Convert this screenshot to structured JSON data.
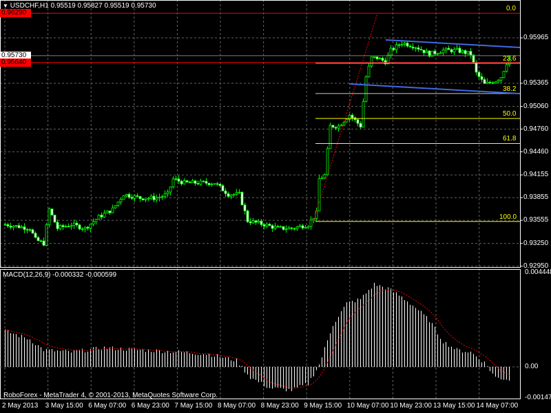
{
  "header": {
    "symbol_line": "USDCHF,H1  0.95519 0.95827 0.95519 0.95730"
  },
  "macd_label": "MACD(12,26,9) -0.000332 -0.000599",
  "footer": "RoboForex - MetaTrader 4, © 2001-2013, MetaQuotes Software Corp.",
  "colors": {
    "bull": "#00ff00",
    "bear": "#00ff00",
    "channel": "#4169e1",
    "fib": "#ffff00",
    "price_line_ask": "#ff0000",
    "bid_line": "#808080",
    "grid": "#646464"
  },
  "price_axis": [
    "0.95965",
    "0.95365",
    "0.95060",
    "0.94760",
    "0.94460",
    "0.94155",
    "0.93855",
    "0.93555",
    "0.93250",
    "0.92950"
  ],
  "price_tags": {
    "high": "0.96290",
    "bid": "0.95730",
    "ask": "0.95640"
  },
  "fib_levels": [
    {
      "label": "0.0",
      "price": 0.9629
    },
    {
      "label": "23.6",
      "price": 0.9563
    },
    {
      "label": "38.2",
      "price": 0.9523
    },
    {
      "label": "50.0",
      "price": 0.949
    },
    {
      "label": "61.8",
      "price": 0.9457
    },
    {
      "label": "100.0",
      "price": 0.9354
    }
  ],
  "macd_axis": [
    "0.004448",
    "0.00",
    "-0.00147"
  ],
  "time_axis": [
    "2 May 2013",
    "3 May 15:00",
    "6 May 07:00",
    "6 May 23:00",
    "7 May 15:00",
    "8 May 07:00",
    "8 May 23:00",
    "9 May 15:00",
    "10 May 07:00",
    "10 May 23:00",
    "13 May 15:00",
    "14 May 07:00"
  ],
  "chart_data": {
    "type": "candlestick",
    "title": "USDCHF,H1",
    "ylim": [
      0.9292,
      0.9639
    ],
    "anchors_bar": [
      1,
      10,
      12,
      15,
      17,
      20,
      25,
      30,
      35,
      40,
      44,
      50,
      56,
      60,
      62,
      66,
      71,
      77,
      82,
      86,
      89,
      95,
      100,
      105,
      111,
      114,
      115,
      117,
      119,
      122,
      126,
      130,
      132,
      134,
      136,
      139,
      141,
      145,
      150,
      155,
      160,
      165,
      170,
      172,
      175,
      179,
      181,
      184
    ],
    "anchors_close": [
      0.935,
      0.9345,
      0.933,
      0.9325,
      0.937,
      0.9345,
      0.935,
      0.9345,
      0.936,
      0.937,
      0.939,
      0.9385,
      0.9385,
      0.939,
      0.941,
      0.9405,
      0.9405,
      0.9405,
      0.939,
      0.939,
      0.9355,
      0.935,
      0.9345,
      0.9345,
      0.935,
      0.9365,
      0.941,
      0.9415,
      0.948,
      0.948,
      0.9495,
      0.948,
      0.9545,
      0.957,
      0.957,
      0.9565,
      0.958,
      0.959,
      0.9585,
      0.9575,
      0.958,
      0.958,
      0.9575,
      0.955,
      0.9535,
      0.954,
      0.9545,
      0.9573
    ],
    "macd": {
      "ylim": [
        -0.00147,
        0.004448
      ],
      "anchors_bar": [
        1,
        10,
        15,
        25,
        37,
        50,
        65,
        75,
        85,
        90,
        97,
        105,
        111,
        115,
        120,
        125,
        130,
        135,
        140,
        145,
        150,
        155,
        160,
        165,
        170,
        175,
        179,
        184
      ],
      "histogram": [
        0.0017,
        0.0013,
        0.0008,
        0.0007,
        0.0009,
        0.0008,
        0.0007,
        0.0006,
        0.0003,
        -0.0005,
        -0.001,
        -0.0011,
        -0.0008,
        0.0001,
        0.002,
        0.003,
        0.0032,
        0.0039,
        0.0037,
        0.0033,
        0.0028,
        0.0022,
        0.0012,
        0.0008,
        0.0007,
        0.0002,
        -0.0005,
        -0.0006
      ]
    }
  }
}
